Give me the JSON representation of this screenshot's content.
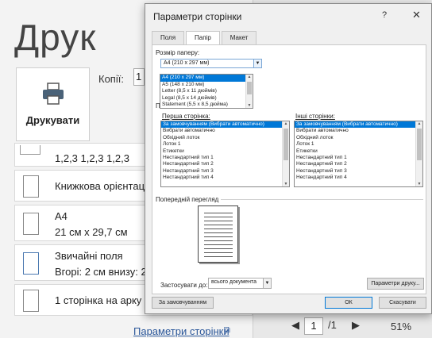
{
  "background": {
    "title": "Друк",
    "print_button_label": "Друкувати",
    "copies_label": "Копії:",
    "copies_value": "1",
    "rows": [
      {
        "line1": "1,2,3    1,2,3    1,2,3",
        "line2": ""
      },
      {
        "line1": "Книжкова орієнтація",
        "line2": ""
      },
      {
        "line1": "А4",
        "line2": "21 см x 29,7 см"
      },
      {
        "line1": "Звичайні поля",
        "line2": "Вгорі: 2 см внизу: 2"
      },
      {
        "line1": "1 сторінка на арку",
        "line2": ""
      }
    ],
    "page_setup_link": "Параметри сторінки",
    "page_current": "1",
    "page_total": "/1",
    "zoom": "51%"
  },
  "dialog": {
    "title": "Параметри сторінки",
    "help": "?",
    "close": "✕",
    "tabs": [
      "Поля",
      "Папір",
      "Макет"
    ],
    "active_tab": 1,
    "paper_size_label": "Розмір паперу:",
    "paper_size_value": "А4 (210 x 297 мм)",
    "paper_options": [
      "А4 (210 x 297 мм)",
      "А5 (148 x 210 мм)",
      "Letter (8,5 x 11 дюймів)",
      "Legal (8,5 x 14 дюймів)",
      "Statement (5,5 x 8,5 дюйма)"
    ],
    "source_label_partial": "По",
    "first_page_label": "Перша сторінка:",
    "other_pages_label": "Інші сторінки:",
    "tray_options": [
      "За замовчуванням (Вибрати автоматично)",
      "Вибрати автоматично",
      "Обхідний лоток",
      "Лоток 1",
      "Етикетки",
      "Нестандартний тип 1",
      "Нестандартний тип 2",
      "Нестандартний тип 3",
      "Нестандартний тип 4"
    ],
    "preview_label": "Попередній перегляд",
    "apply_to_label": "Застосувати до:",
    "apply_to_value": "всього документа",
    "print_options_button": "Параметри друку...",
    "default_button": "За замовчуванням",
    "ok_button": "ОК",
    "cancel_button": "Скасувати"
  }
}
